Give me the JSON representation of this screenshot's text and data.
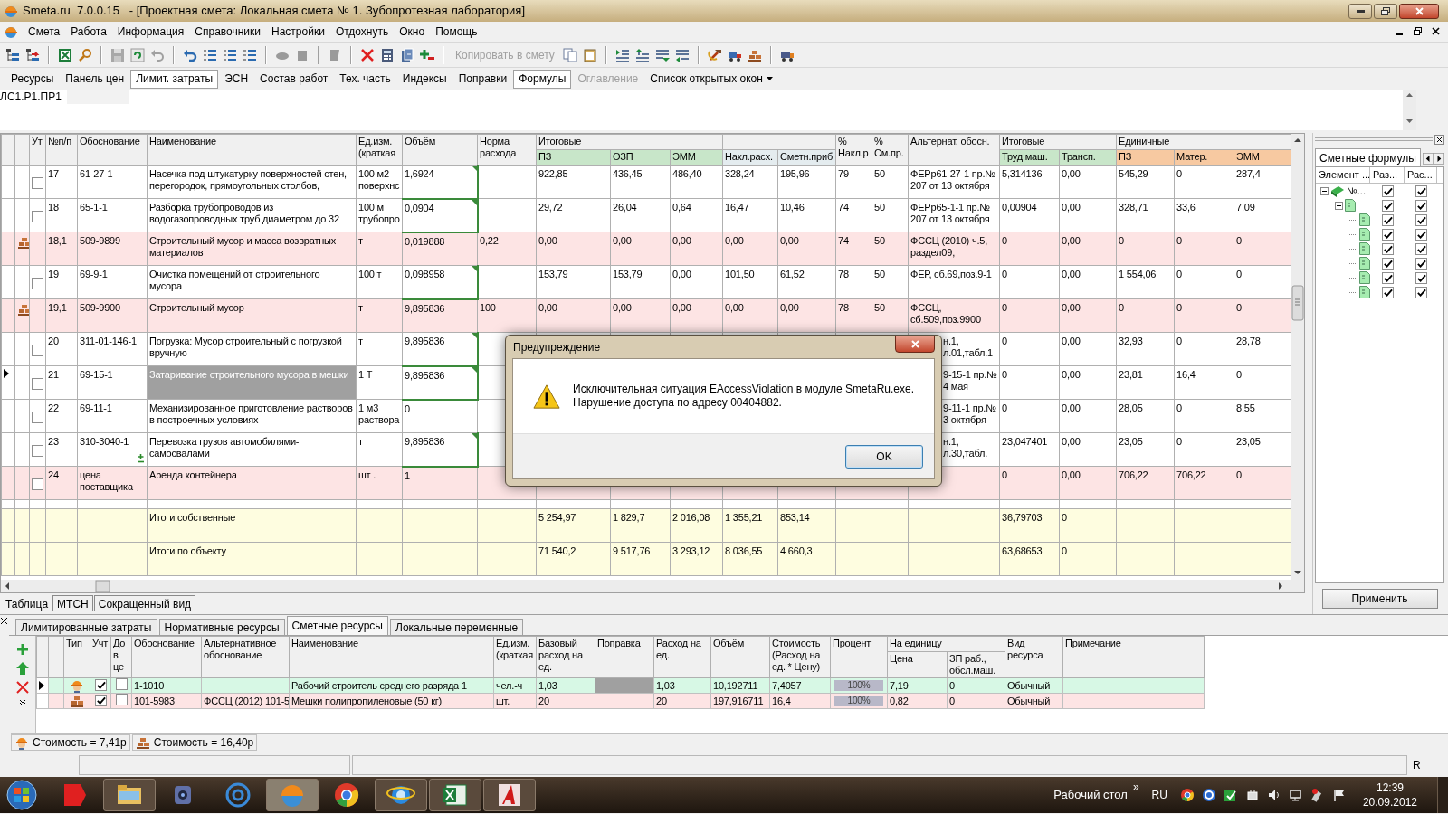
{
  "window": {
    "title": "Smeta.ru  7.0.0.15   - [Проектная смета: Локальная смета № 1. Зубопротезная лаборатория]"
  },
  "menu": [
    "Смета",
    "Работа",
    "Информация",
    "Справочники",
    "Настройки",
    "Отдохнуть",
    "Окно",
    "Помощь"
  ],
  "toolbar": {
    "copy_button": {
      "label": "Копировать в смету",
      "disabled": true
    }
  },
  "view_buttons": [
    {
      "label": "Ресурсы",
      "kind": "button",
      "selected": false,
      "disabled": false
    },
    {
      "label": "Панель цен",
      "kind": "button",
      "selected": false,
      "disabled": false
    },
    {
      "label": "Лимит. затраты",
      "kind": "button",
      "selected": true,
      "disabled": false
    },
    {
      "label": "ЭСН",
      "kind": "button",
      "selected": false,
      "disabled": false
    },
    {
      "label": "Состав работ",
      "kind": "button",
      "selected": false,
      "disabled": false
    },
    {
      "label": "Тех. часть",
      "kind": "button",
      "selected": false,
      "disabled": false
    },
    {
      "label": "Индексы",
      "kind": "button",
      "selected": false,
      "disabled": false
    },
    {
      "label": "Поправки",
      "kind": "button",
      "selected": false,
      "disabled": false
    },
    {
      "label": "Формулы",
      "kind": "button",
      "selected": true,
      "disabled": false
    },
    {
      "label": "Оглавление",
      "kind": "button",
      "selected": false,
      "disabled": true
    },
    {
      "label": "Список открытых окон",
      "kind": "dropdown",
      "selected": false,
      "disabled": false
    }
  ],
  "path": "ЛС1.Р1.ПР1",
  "grid": {
    "columns": [
      {
        "label": "Ут"
      },
      {
        "label": "№п/п"
      },
      {
        "label": "Обоснование"
      },
      {
        "label": "Наименование"
      },
      {
        "label": "Ед.изм. (краткая"
      },
      {
        "label": "Объём"
      },
      {
        "label": "Норма расхода"
      },
      {
        "label": "Итоговые",
        "columns": [
          {
            "label": "ПЗ",
            "color": "#c8e6c9"
          },
          {
            "label": "ОЗП",
            "color": "#c8e6c9"
          },
          {
            "label": "ЭММ",
            "color": "#c8e6c9"
          }
        ]
      },
      {
        "columns": [
          {
            "label": "Накл.расх.",
            "color": "#e4ecef"
          },
          {
            "label": "Сметн.приб",
            "color": "#e4ecef"
          }
        ]
      },
      {
        "label": "% Накл.р"
      },
      {
        "label": "% См.пр."
      },
      {
        "label": "Альтернат. обосн."
      },
      {
        "label": "Итоговые",
        "columns": [
          {
            "label": "Труд.маш.",
            "color": "#c8e6c9"
          },
          {
            "label": "Трансп.",
            "color": "#c8e6c9"
          }
        ]
      },
      {
        "label": "Единичные",
        "columns": [
          {
            "label": "ПЗ",
            "color": "#f7c9a1"
          },
          {
            "label": "Матер.",
            "color": "#f7c9a1"
          },
          {
            "label": "ЭММ",
            "color": "#f7c9a1"
          }
        ]
      }
    ],
    "rows": [
      {
        "kind": "work",
        "selected": false,
        "checked": false,
        "volume_edited": true,
        "plus_mark": false,
        "alt_partly_hidden": false,
        "number": "17",
        "code": "61-27-1",
        "name": "Насечка под штукатурку поверхностей стен, перегородок, прямоугольных столбов,",
        "unit": "100 м2 поверхнс",
        "volume": "1,6924",
        "total_pz": "922,85",
        "total_ozp": "436,45",
        "total_emm": "486,40",
        "overhead": "328,24",
        "profit": "195,96",
        "overhead_pct": "79",
        "profit_pct": "50",
        "alt_code": "ФЕРр61-27-1 пр.№ 207 от 13 октября",
        "total_machine_labor": "5,314136",
        "total_transport": "0,00",
        "unit_pz": "545,29",
        "unit_materials": "0",
        "unit_emm": "287,4"
      },
      {
        "kind": "work",
        "selected": false,
        "checked": false,
        "volume_edited": true,
        "plus_mark": false,
        "alt_partly_hidden": false,
        "number": "18",
        "code": "65-1-1",
        "name": "Разборка трубопроводов из водогазопроводных труб диаметром до 32",
        "unit": "100 м трубопро",
        "volume": "0,0904",
        "total_pz": "29,72",
        "total_ozp": "26,04",
        "total_emm": "0,64",
        "overhead": "16,47",
        "profit": "10,46",
        "overhead_pct": "74",
        "profit_pct": "50",
        "alt_code": "ФЕРр65-1-1 пр.№ 207 от 13 октября",
        "total_machine_labor": "0,00904",
        "total_transport": "0,00",
        "unit_pz": "328,71",
        "unit_materials": "33,6",
        "unit_emm": "7,09"
      },
      {
        "kind": "material",
        "selected": false,
        "volume_edited": false,
        "plus_mark": false,
        "alt_partly_hidden": false,
        "number": "18,1",
        "code": "509-9899",
        "name": "Строительный мусор и масса возвратных материалов",
        "unit": "т",
        "volume": "0,019888",
        "norm": "0,22",
        "total_pz": "0,00",
        "total_ozp": "0,00",
        "total_emm": "0,00",
        "overhead": "0,00",
        "profit": "0,00",
        "overhead_pct": "74",
        "profit_pct": "50",
        "alt_code": "ФССЦ (2010) ч.5, раздел09,",
        "total_machine_labor": "0",
        "total_transport": "0,00",
        "unit_pz": "0",
        "unit_materials": "0",
        "unit_emm": "0"
      },
      {
        "kind": "work",
        "selected": false,
        "checked": false,
        "volume_edited": true,
        "plus_mark": false,
        "alt_partly_hidden": false,
        "number": "19",
        "code": "69-9-1",
        "name": "Очистка помещений от строительного мусора",
        "unit": "100 т",
        "volume": "0,098958",
        "total_pz": "153,79",
        "total_ozp": "153,79",
        "total_emm": "0,00",
        "overhead": "101,50",
        "profit": "61,52",
        "overhead_pct": "78",
        "profit_pct": "50",
        "alt_code": "ФЕР, сб.69,поз.9-1",
        "total_machine_labor": "0",
        "total_transport": "0,00",
        "unit_pz": "1 554,06",
        "unit_materials": "0",
        "unit_emm": "0"
      },
      {
        "kind": "material",
        "selected": false,
        "volume_edited": false,
        "plus_mark": false,
        "alt_partly_hidden": false,
        "number": "19,1",
        "code": "509-9900",
        "name": "Строительный мусор",
        "unit": "т",
        "volume": "9,895836",
        "norm": "100",
        "total_pz": "0,00",
        "total_ozp": "0,00",
        "total_emm": "0,00",
        "overhead": "0,00",
        "profit": "0,00",
        "overhead_pct": "78",
        "profit_pct": "50",
        "alt_code": "ФССЦ, сб.509,поз.9900",
        "total_machine_labor": "0",
        "total_transport": "0,00",
        "unit_pz": "0",
        "unit_materials": "0",
        "unit_emm": "0"
      },
      {
        "kind": "work",
        "selected": false,
        "checked": false,
        "volume_edited": true,
        "plus_mark": false,
        "alt_partly_hidden": true,
        "number": "20",
        "code": "311-01-146-1",
        "name": "Погрузка: Мусор строительный с погрузкой вручную",
        "unit": "т",
        "volume": "9,895836",
        "alt_code": "н.1, л.01,табл.1",
        "total_machine_labor": "0",
        "total_transport": "0,00",
        "unit_pz": "32,93",
        "unit_materials": "0",
        "unit_emm": "28,78"
      },
      {
        "kind": "work",
        "selected": true,
        "checked": false,
        "volume_edited": true,
        "plus_mark": false,
        "alt_partly_hidden": true,
        "number": "21",
        "code": "69-15-1",
        "name": "Затаривание строительного мусора в мешки",
        "unit": "1 Т",
        "volume": "9,895836",
        "alt_code": "9-15-1 пр.№ 4 мая",
        "total_machine_labor": "0",
        "total_transport": "0,00",
        "unit_pz": "23,81",
        "unit_materials": "16,4",
        "unit_emm": "0"
      },
      {
        "kind": "work",
        "selected": false,
        "checked": false,
        "volume_edited": false,
        "plus_mark": false,
        "alt_partly_hidden": true,
        "number": "22",
        "code": "69-11-1",
        "name": "Механизированное приготовление растворов в построечных условиях",
        "unit": "1 м3 раствора",
        "volume": "0",
        "alt_code": "9-11-1 пр.№ 3 октября",
        "total_machine_labor": "0",
        "total_transport": "0,00",
        "unit_pz": "28,05",
        "unit_materials": "0",
        "unit_emm": "8,55"
      },
      {
        "kind": "work",
        "selected": false,
        "checked": false,
        "volume_edited": true,
        "plus_mark": true,
        "alt_partly_hidden": true,
        "number": "23",
        "code": "310-3040-1",
        "name": "Перевозка грузов автомобилями-самосвалами",
        "unit": "т",
        "volume": "9,895836",
        "alt_code": "н.1, л.30,табл.",
        "total_machine_labor": "23,047401",
        "total_transport": "0,00",
        "unit_pz": "23,05",
        "unit_materials": "0",
        "unit_emm": "23,05"
      },
      {
        "kind": "supplier",
        "selected": false,
        "checked": false,
        "volume_edited": false,
        "plus_mark": false,
        "alt_partly_hidden": false,
        "number": "24",
        "code": "цена поставщика",
        "name": "Аренда контейнера",
        "unit": "шт .",
        "volume": "1",
        "total_machine_labor": "0",
        "total_transport": "0,00",
        "unit_pz": "706,22",
        "unit_materials": "706,22",
        "unit_emm": "0"
      }
    ],
    "totals": [
      {
        "name": "Итоги собственные",
        "total_pz": "5 254,97",
        "total_ozp": "1 829,7",
        "total_emm": "2 016,08",
        "overhead": "1 355,21",
        "profit": "853,14",
        "total_machine_labor": "36,79703",
        "total_transport": "0"
      },
      {
        "name": "Итоги по объекту",
        "total_pz": "71 540,2",
        "total_ozp": "9 517,76",
        "total_emm": "3 293,12",
        "overhead": "8 036,55",
        "profit": "4 660,3",
        "total_machine_labor": "63,68653",
        "total_transport": "0"
      }
    ]
  },
  "dialog": {
    "title": "Предупреждение",
    "message": [
      "Исключительная ситуация EAccessViolation в модуле SmetaRu.exe.",
      "Нарушение доступа по адресу 00404882."
    ],
    "ok_button": "OK"
  },
  "side_panel": {
    "tab": "Сметные формулы",
    "columns": [
      "Элемент ...",
      "Раз...",
      "Рас..."
    ],
    "tree": [
      {
        "label": "№...",
        "kind": "book",
        "expanded": true,
        "column_2_checked": true,
        "column_3_checked": true,
        "children": [
          {
            "kind": "document",
            "expanded": true,
            "column_2_checked": true,
            "column_3_checked": true,
            "children": [
              {
                "kind": "document",
                "column_2_checked": true,
                "column_3_checked": true
              },
              {
                "kind": "document",
                "column_2_checked": true,
                "column_3_checked": true
              },
              {
                "kind": "document",
                "column_2_checked": true,
                "column_3_checked": true
              },
              {
                "kind": "document",
                "column_2_checked": true,
                "column_3_checked": true
              },
              {
                "kind": "document",
                "column_2_checked": true,
                "column_3_checked": true
              },
              {
                "kind": "document",
                "column_2_checked": true,
                "column_3_checked": true
              }
            ]
          }
        ]
      }
    ],
    "apply_button": "Применить"
  },
  "view_tabs": [
    {
      "label": "Таблица",
      "selected": true
    },
    {
      "label": "МТСН",
      "selected": false
    },
    {
      "label": "Сокращенный вид",
      "selected": false
    }
  ],
  "resources": {
    "tabs": [
      {
        "label": "Лимитированные затраты",
        "selected": false
      },
      {
        "label": "Нормативные ресурсы",
        "selected": false
      },
      {
        "label": "Сметные ресурсы",
        "selected": true
      },
      {
        "label": "Локальные переменные",
        "selected": false
      }
    ],
    "columns": [
      {
        "label": "Тип"
      },
      {
        "label": "Учт"
      },
      {
        "label": "До в це"
      },
      {
        "label": "Обоснование"
      },
      {
        "label": "Альтернативное обоснование"
      },
      {
        "label": "Наименование"
      },
      {
        "label": "Ед.изм. (краткая"
      },
      {
        "label": "Базовый расход на ед."
      },
      {
        "label": "Поправка"
      },
      {
        "label": "Расход на ед."
      },
      {
        "label": "Объём"
      },
      {
        "label": "Стоимость (Расход на ед. * Цену)"
      },
      {
        "label": "Процент"
      },
      {
        "label": "На единицу",
        "columns": [
          {
            "label": "Цена"
          },
          {
            "label": "ЗП раб., обсл.маш."
          }
        ]
      },
      {
        "label": "Вид ресурса"
      },
      {
        "label": "Примечание"
      }
    ],
    "rows": [
      {
        "kind": "worker",
        "selected": true,
        "counted": true,
        "in_price": false,
        "correction_focused": true,
        "code": "1-1010",
        "name": "Рабочий строитель среднего разряда 1",
        "unit": "чел.-ч",
        "base_rate": "1,03",
        "rate": "1,03",
        "volume": "10,192711",
        "cost": "7,4057",
        "percent": {
          "level": 1,
          "text": "100%"
        },
        "price": "7,19",
        "wage": "0",
        "resource_type": "Обычный"
      },
      {
        "kind": "material",
        "selected": false,
        "counted": true,
        "in_price": false,
        "correction_focused": false,
        "code": "101-5983",
        "alt_code": "ФССЦ (2012) 101-5",
        "name": "Мешки полипропиленовые (50 кг)",
        "unit": "шт.",
        "base_rate": "20",
        "rate": "20",
        "volume": "197,916711",
        "cost": "16,4",
        "percent": {
          "level": 1,
          "text": "100%"
        },
        "price": "0,82",
        "wage": "0",
        "resource_type": "Обычный"
      }
    ],
    "costs": [
      {
        "kind": "worker",
        "text": "Стоимость = 7,41р"
      },
      {
        "kind": "material",
        "text": "Стоимость = 16,40р"
      }
    ]
  },
  "status_bar": {
    "language": "R"
  },
  "taskbar": {
    "apps": [
      {
        "kind": "yandex",
        "running": false,
        "active": false
      },
      {
        "kind": "explorer",
        "running": true,
        "active": false
      },
      {
        "kind": "webcam",
        "running": false,
        "active": false
      },
      {
        "kind": "mail",
        "running": false,
        "active": false
      },
      {
        "kind": "smeta",
        "running": true,
        "active": true
      },
      {
        "kind": "chrome",
        "running": false,
        "active": false
      },
      {
        "kind": "ie",
        "running": true,
        "active": false
      },
      {
        "kind": "excel",
        "running": true,
        "active": false
      },
      {
        "kind": "autocad",
        "running": true,
        "active": false
      }
    ],
    "desktop_label": "Рабочий стол",
    "chevron": "»",
    "language": "RU",
    "time": "12:39",
    "date": "20.09.2012"
  }
}
